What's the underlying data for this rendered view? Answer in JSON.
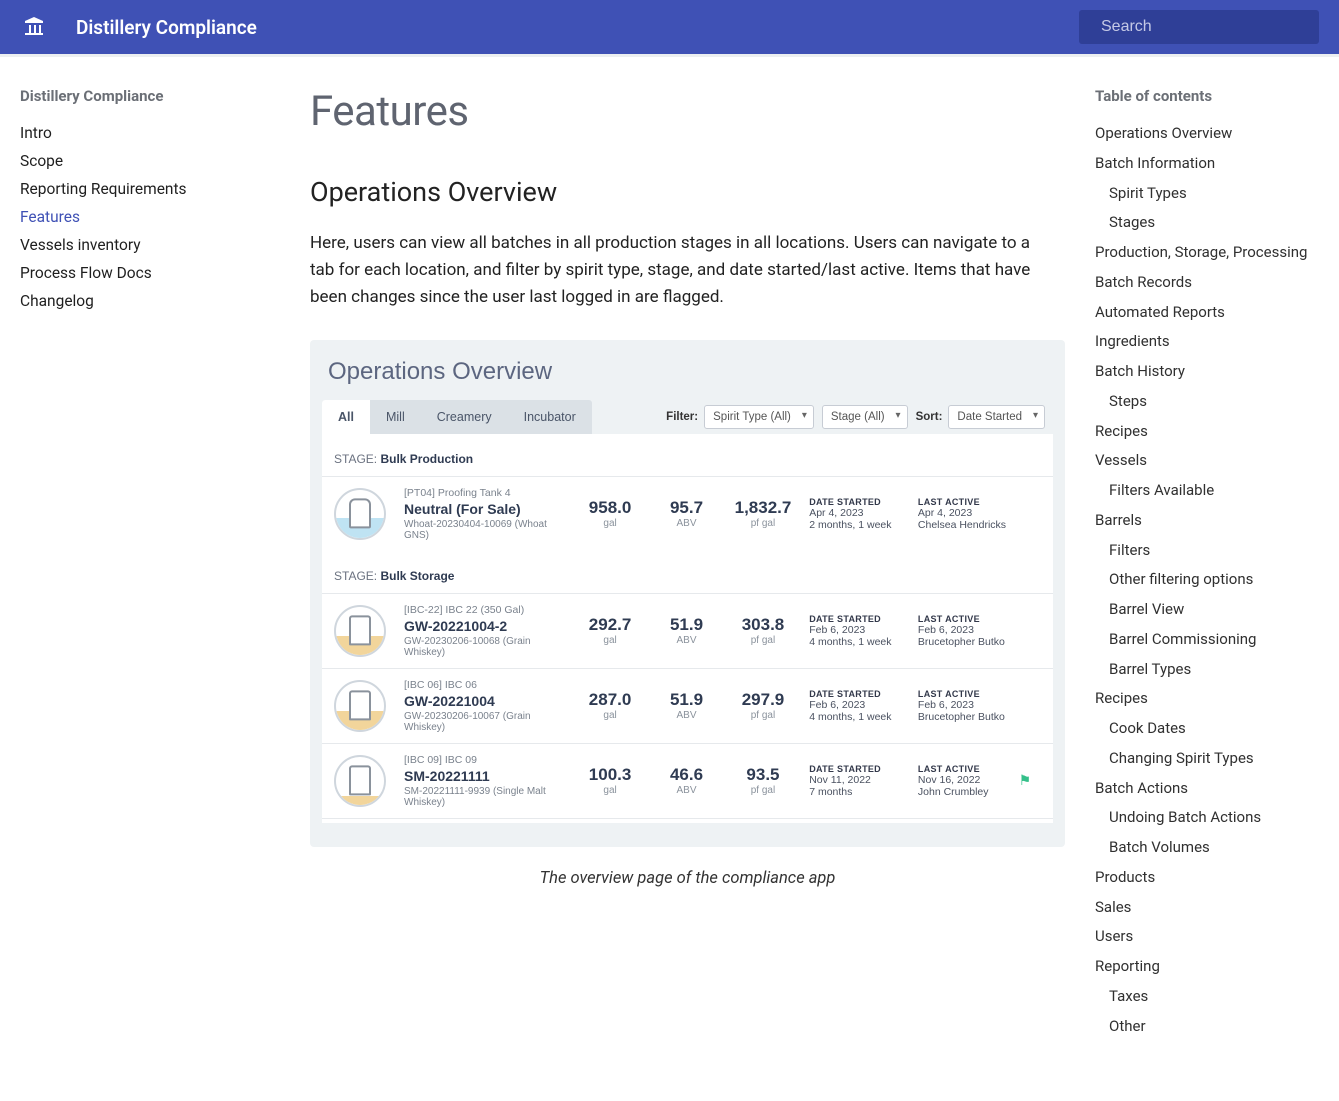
{
  "header": {
    "title": "Distillery Compliance",
    "search_placeholder": "Search"
  },
  "sidebar": {
    "heading": "Distillery Compliance",
    "items": [
      {
        "label": "Intro",
        "active": false
      },
      {
        "label": "Scope",
        "active": false
      },
      {
        "label": "Reporting Requirements",
        "active": false
      },
      {
        "label": "Features",
        "active": true
      },
      {
        "label": "Vessels inventory",
        "active": false
      },
      {
        "label": "Process Flow Docs",
        "active": false
      },
      {
        "label": "Changelog",
        "active": false
      }
    ]
  },
  "main": {
    "page_title": "Features",
    "section_heading": "Operations Overview",
    "lead": "Here, users can view all batches in all production stages in all locations. Users can navigate to a tab for each location, and filter by spirit type, stage, and date started/last active. Items that have been changes since the user last logged in are flagged.",
    "caption": "The overview page of the compliance app"
  },
  "mock": {
    "title": "Operations Overview",
    "tabs": [
      "All",
      "Mill",
      "Creamery",
      "Incubator"
    ],
    "filter_label": "Filter:",
    "sort_label": "Sort:",
    "filter1": "Spirit Type (All)",
    "filter2": "Stage (All)",
    "sort": "Date Started",
    "stage1_prefix": "STAGE:",
    "stage1_name": "Bulk Production",
    "stage2_prefix": "STAGE:",
    "stage2_name": "Bulk Storage",
    "rows": [
      {
        "sub": "[PT04] Proofing Tank 4",
        "name": "Neutral (For Sale)",
        "detail": "Whoat-20230404-10069 (Whoat GNS)",
        "gal": "958.0",
        "abv": "95.7",
        "pfgal": "1,832.7",
        "date_started": "Apr 4, 2023",
        "age": "2 months, 1 week",
        "last_active": "Apr 4, 2023",
        "user": "Chelsea Hendricks",
        "flag": false
      },
      {
        "sub": "[IBC-22] IBC 22 (350 Gal)",
        "name": "GW-20221004-2",
        "detail": "GW-20230206-10068 (Grain Whiskey)",
        "gal": "292.7",
        "abv": "51.9",
        "pfgal": "303.8",
        "date_started": "Feb 6, 2023",
        "age": "4 months, 1 week",
        "last_active": "Feb 6, 2023",
        "user": "Brucetopher Butko",
        "flag": false
      },
      {
        "sub": "[IBC 06] IBC 06",
        "name": "GW-20221004",
        "detail": "GW-20230206-10067 (Grain Whiskey)",
        "gal": "287.0",
        "abv": "51.9",
        "pfgal": "297.9",
        "date_started": "Feb 6, 2023",
        "age": "4 months, 1 week",
        "last_active": "Feb 6, 2023",
        "user": "Brucetopher Butko",
        "flag": false
      },
      {
        "sub": "[IBC 09] IBC 09",
        "name": "SM-20221111",
        "detail": "SM-20221111-9939 (Single Malt Whiskey)",
        "gal": "100.3",
        "abv": "46.6",
        "pfgal": "93.5",
        "date_started": "Nov 11, 2022",
        "age": "7 months",
        "last_active": "Nov 16, 2022",
        "user": "John Crumbley",
        "flag": true
      }
    ],
    "unit_gal": "gal",
    "unit_abv": "ABV",
    "unit_pfgal": "pf gal",
    "lbl_date_started": "DATE STARTED",
    "lbl_last_active": "LAST ACTIVE"
  },
  "toc": {
    "heading": "Table of contents",
    "items": [
      {
        "label": "Operations Overview",
        "sub": false
      },
      {
        "label": "Batch Information",
        "sub": false
      },
      {
        "label": "Spirit Types",
        "sub": true
      },
      {
        "label": "Stages",
        "sub": true
      },
      {
        "label": "Production, Storage, Processing",
        "sub": false
      },
      {
        "label": "Batch Records",
        "sub": false
      },
      {
        "label": "Automated Reports",
        "sub": false
      },
      {
        "label": "Ingredients",
        "sub": false
      },
      {
        "label": "Batch History",
        "sub": false
      },
      {
        "label": "Steps",
        "sub": true
      },
      {
        "label": "Recipes",
        "sub": false
      },
      {
        "label": "Vessels",
        "sub": false
      },
      {
        "label": "Filters Available",
        "sub": true
      },
      {
        "label": "Barrels",
        "sub": false
      },
      {
        "label": "Filters",
        "sub": true
      },
      {
        "label": "Other filtering options",
        "sub": true
      },
      {
        "label": "Barrel View",
        "sub": true
      },
      {
        "label": "Barrel Commissioning",
        "sub": true
      },
      {
        "label": "Barrel Types",
        "sub": true
      },
      {
        "label": "Recipes",
        "sub": false
      },
      {
        "label": "Cook Dates",
        "sub": true
      },
      {
        "label": "Changing Spirit Types",
        "sub": true
      },
      {
        "label": "Batch Actions",
        "sub": false
      },
      {
        "label": "Undoing Batch Actions",
        "sub": true
      },
      {
        "label": "Batch Volumes",
        "sub": true
      },
      {
        "label": "Products",
        "sub": false
      },
      {
        "label": "Sales",
        "sub": false
      },
      {
        "label": "Users",
        "sub": false
      },
      {
        "label": "Reporting",
        "sub": false
      },
      {
        "label": "Taxes",
        "sub": true
      },
      {
        "label": "Other",
        "sub": true
      }
    ]
  }
}
